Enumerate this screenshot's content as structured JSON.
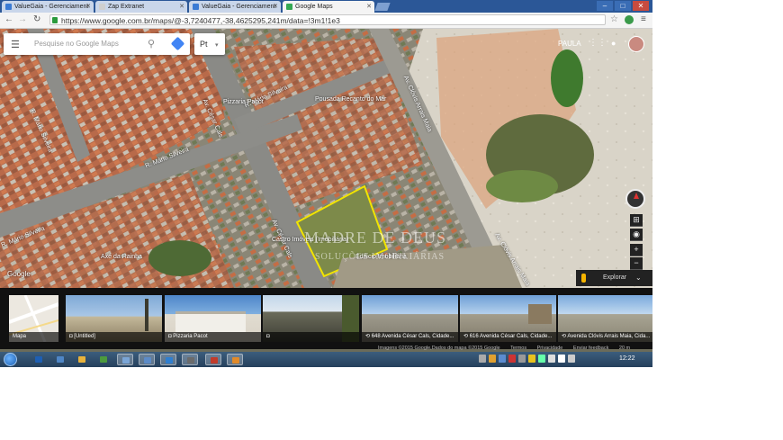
{
  "browser": {
    "tabs": [
      {
        "label": "ValueGaia - Gerenciament",
        "favicon_color": "#3b7bd4",
        "active": false
      },
      {
        "label": "Zap Extranet",
        "favicon_color": "#cfcfcf",
        "active": false
      },
      {
        "label": "ValueGaia - Gerenciament",
        "favicon_color": "#3b7bd4",
        "active": false
      },
      {
        "label": "Google Maps",
        "favicon_color": "#34a853",
        "active": true
      }
    ],
    "url": "https://www.google.com.br/maps/@-3,7240477,-38,4625295,241m/data=!3m1!1e3",
    "window_buttons": [
      "–",
      "□",
      "✕"
    ]
  },
  "maps": {
    "search_placeholder": "Pesquise no Google Maps",
    "language": "Pt",
    "user_name": "PAULA",
    "road_labels": [
      "Av. César Cals",
      "R. Mário Silveira",
      "R. Mário Silveira",
      "R. Mário Silveira",
      "Av. Clóvis Arrais Maia",
      "Av. Clóvis Arrais Maia",
      "R. Mário Silveira",
      "Av. César Cals"
    ],
    "poi_labels": [
      "Pizzaria Pacot",
      "Pousada Recanto do Mar",
      "Castro Imóveis (Imobiliária)",
      "Edifício Imobiliária",
      "Axé da Rainha",
      "Google"
    ],
    "watermark_line1": "MADRE DE DEUS",
    "watermark_line2": "SOLUÇÕES IMOBILIÁRIAS",
    "explorer_label": "Explorar",
    "thumbnails": [
      {
        "caption": "Mapa",
        "kind": "map"
      },
      {
        "caption": "[Untitled]",
        "kind": "beach"
      },
      {
        "caption": "Pizzaria Pacot",
        "kind": "building"
      },
      {
        "caption": "",
        "kind": "street"
      },
      {
        "caption": "648 Avenida César Cals, Cidade...",
        "kind": "street"
      },
      {
        "caption": "616 Avenida César Cals, Cidade...",
        "kind": "street"
      },
      {
        "caption": "Avenida Clóvis Arrais Maia, Cida...",
        "kind": "street"
      }
    ],
    "attribution": {
      "imagery": "Imagens ©2015 Google,Dados do mapa ©2015 Google",
      "terms": "Termos",
      "privacy": "Privacidade",
      "feedback": "Enviar feedback",
      "scale": "20 m"
    }
  },
  "taskbar": {
    "pinned_colors": [
      "#1e5fb3",
      "#4f86c6",
      "#e8b23b",
      "#4c9a3d",
      "#7aa5d6",
      "#5c8bc7",
      "#2f7fd0",
      "#6b6b6b",
      "#c23b2a",
      "#e08a2a"
    ],
    "active_index": 4,
    "tray_colors": [
      "#aaa",
      "#e0a030",
      "#5b8bd0",
      "#c33",
      "#999",
      "#e8c21e",
      "#6fa",
      "#ddd",
      "#fff",
      "#ccc"
    ],
    "clock": "12:22"
  }
}
